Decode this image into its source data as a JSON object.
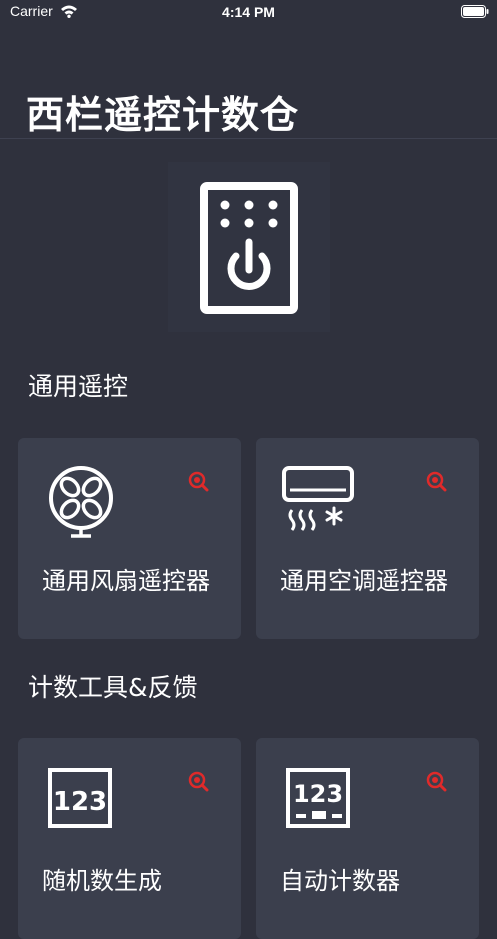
{
  "status_bar": {
    "carrier": "Carrier",
    "time": "4:14 PM"
  },
  "header": {
    "title": "西栏遥控计数仓"
  },
  "sections": [
    {
      "title": "通用遥控",
      "cards": [
        {
          "label": "通用风扇遥控器",
          "icon": "fan-icon"
        },
        {
          "label": "通用空调遥控器",
          "icon": "air-conditioner-icon"
        }
      ]
    },
    {
      "title": "计数工具&反馈",
      "cards": [
        {
          "label": "随机数生成",
          "icon": "number-box-icon"
        },
        {
          "label": "自动计数器",
          "icon": "counter-icon"
        }
      ]
    }
  ],
  "colors": {
    "background": "#2f313d",
    "card": "#3b3f4d",
    "badge": "#e02a2a",
    "text": "#ffffff"
  }
}
